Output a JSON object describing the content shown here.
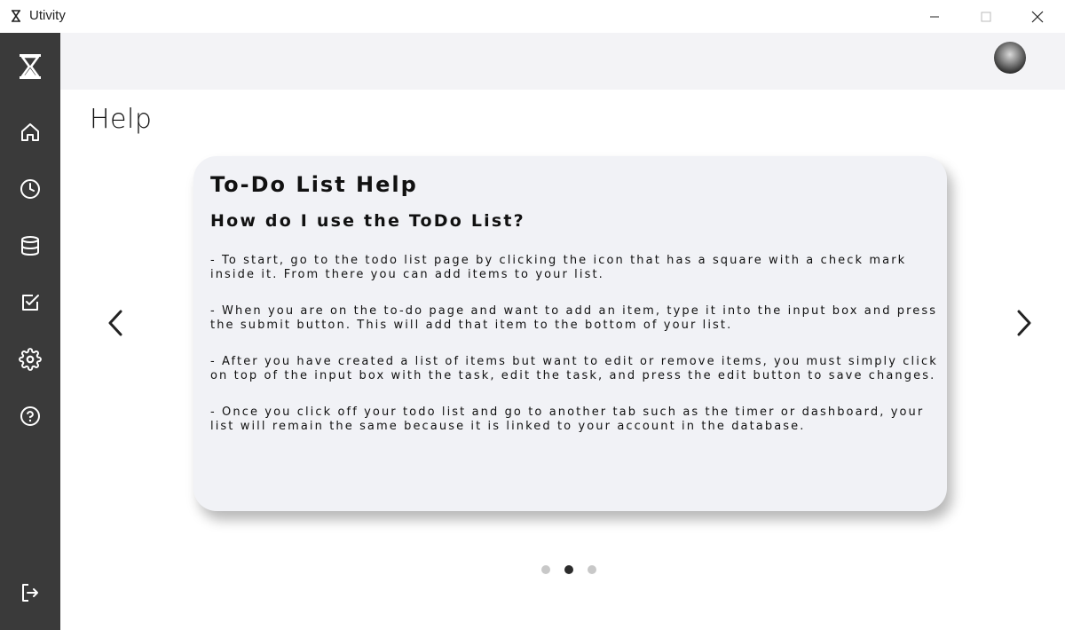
{
  "window": {
    "title": "Utivity"
  },
  "sidebar": {
    "items": [
      {
        "icon": "hourglass-logo-icon"
      },
      {
        "icon": "home-icon"
      },
      {
        "icon": "clock-icon"
      },
      {
        "icon": "database-icon"
      },
      {
        "icon": "checkbox-icon"
      },
      {
        "icon": "gear-icon"
      },
      {
        "icon": "help-circle-icon"
      },
      {
        "icon": "logout-icon"
      }
    ],
    "background": "#3a3a3a"
  },
  "page": {
    "title": "Help"
  },
  "carousel": {
    "card": {
      "title": "To-Do List Help",
      "subtitle": "How do I use the ToDo List?",
      "paragraphs": [
        "- To start, go to the todo list page by clicking the icon that has a square with a check mark inside it. From there you can add items to your list.",
        "- When you are on the to-do page and want to add an item, type it into the input box and press the submit button. This will add that item to the bottom of your list.",
        "- After you have created a list of items but want to edit or remove items, you must simply click on top of the input box with the task, edit the task, and press the edit button to save changes.",
        "- Once you click off your todo list and go to another tab such as the timer or dashboard, your list will remain the same because it is linked to your account in the database."
      ]
    },
    "slide_count": 3,
    "active_slide": 2
  }
}
